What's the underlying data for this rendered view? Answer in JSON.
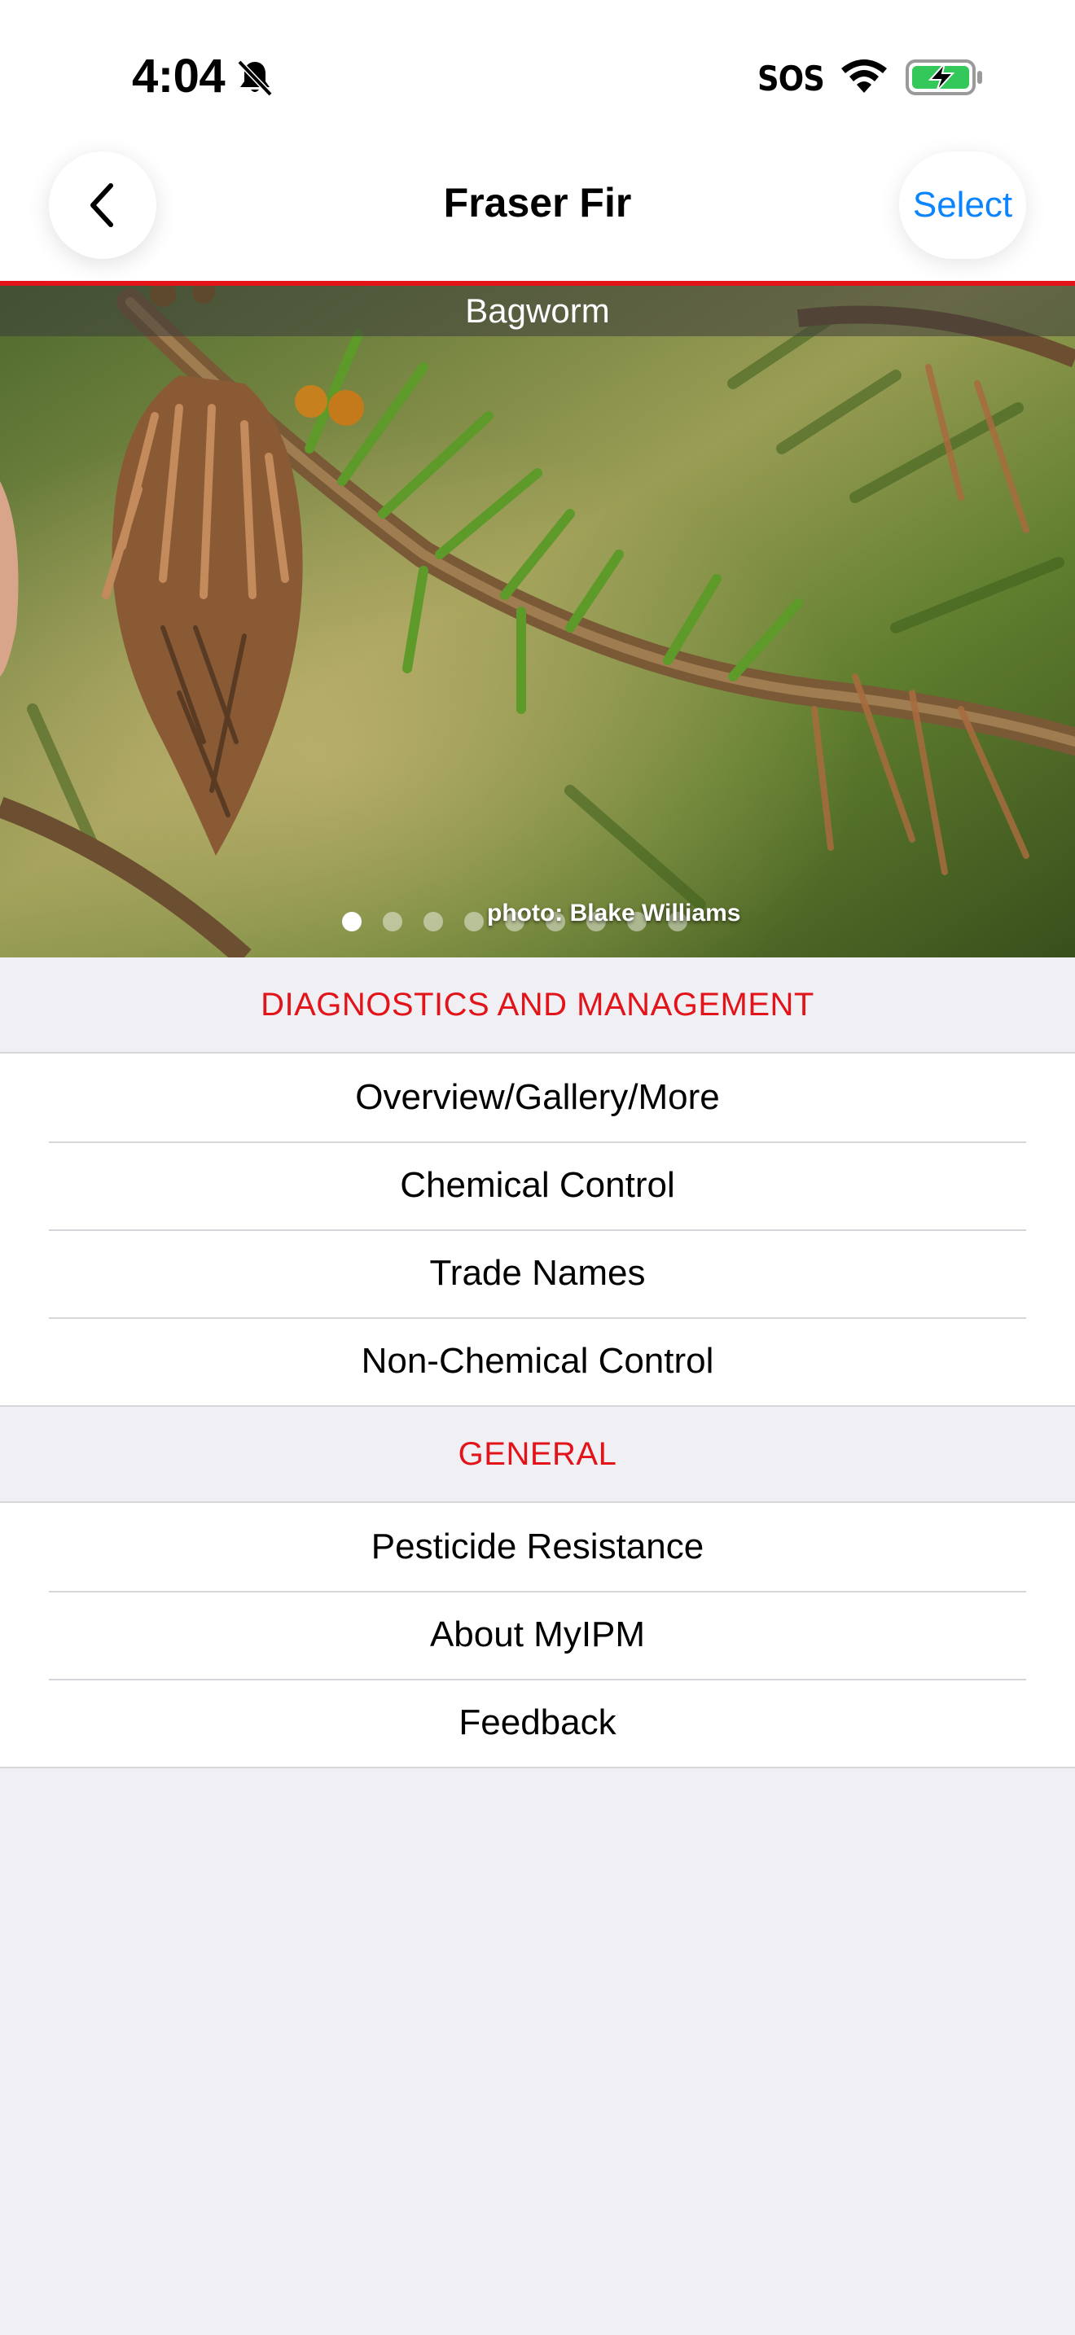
{
  "status_bar": {
    "time": "4:04",
    "sos": "SOS",
    "icons": [
      "bell-slash-icon",
      "wifi-icon",
      "battery-charging-icon"
    ]
  },
  "nav": {
    "title": "Fraser Fir",
    "select_label": "Select",
    "back_icon": "chevron-left-icon"
  },
  "hero": {
    "title": "Bagworm",
    "credit": "photo: Blake Williams",
    "page_count": 9,
    "current_page": 1
  },
  "sections": [
    {
      "header": "DIAGNOSTICS AND MANAGEMENT",
      "items": [
        "Overview/Gallery/More",
        "Chemical Control",
        "Trade Names",
        "Non-Chemical Control"
      ]
    },
    {
      "header": "GENERAL",
      "items": [
        "Pesticide Resistance",
        "About MyIPM",
        "Feedback"
      ]
    }
  ],
  "colors": {
    "accent_red": "#e2141a",
    "link_blue": "#0a84ff",
    "background": "#efeff4"
  }
}
